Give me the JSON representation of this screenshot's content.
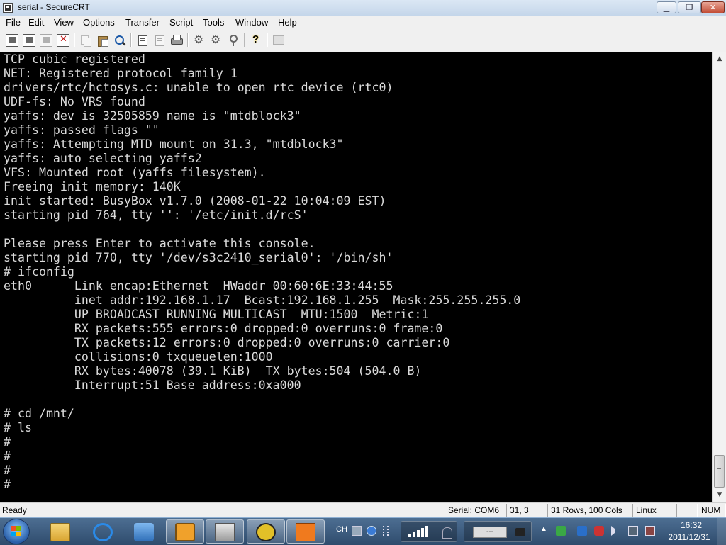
{
  "window": {
    "title": "serial - SecureCRT",
    "min_glyph": "▁",
    "max_glyph": "❐",
    "close_glyph": "✕"
  },
  "menu": {
    "items": [
      "File",
      "Edit",
      "View",
      "Options",
      "Transfer",
      "Script",
      "Tools",
      "Window",
      "Help"
    ]
  },
  "terminal": {
    "lines": [
      "TCP cubic registered",
      "NET: Registered protocol family 1",
      "drivers/rtc/hctosys.c: unable to open rtc device (rtc0)",
      "UDF-fs: No VRS found",
      "yaffs: dev is 32505859 name is \"mtdblock3\"",
      "yaffs: passed flags \"\"",
      "yaffs: Attempting MTD mount on 31.3, \"mtdblock3\"",
      "yaffs: auto selecting yaffs2",
      "VFS: Mounted root (yaffs filesystem).",
      "Freeing init memory: 140K",
      "init started: BusyBox v1.7.0 (2008-01-22 10:04:09 EST)",
      "starting pid 764, tty '': '/etc/init.d/rcS'",
      "",
      "Please press Enter to activate this console.",
      "starting pid 770, tty '/dev/s3c2410_serial0': '/bin/sh'",
      "# ifconfig",
      "eth0      Link encap:Ethernet  HWaddr 00:60:6E:33:44:55",
      "          inet addr:192.168.1.17  Bcast:192.168.1.255  Mask:255.255.255.0",
      "          UP BROADCAST RUNNING MULTICAST  MTU:1500  Metric:1",
      "          RX packets:555 errors:0 dropped:0 overruns:0 frame:0",
      "          TX packets:12 errors:0 dropped:0 overruns:0 carrier:0",
      "          collisions:0 txqueuelen:1000",
      "          RX bytes:40078 (39.1 KiB)  TX bytes:504 (504.0 B)",
      "          Interrupt:51 Base address:0xa000",
      "",
      "# cd /mnt/",
      "# ls",
      "#",
      "#",
      "#",
      "#"
    ],
    "text_color": "#dadada",
    "background": "#000000"
  },
  "status": {
    "ready": "Ready",
    "connection": "Serial: COM6",
    "cursor_position": "31,   3",
    "size": "31 Rows, 100 Cols",
    "emulation": "Linux",
    "num": "NUM"
  },
  "taskbar": {
    "language": "CH",
    "clock_time": "16:32",
    "clock_date": "2011/12/31",
    "tray_placeholder": "---"
  },
  "icons": {
    "app": "securecrt-icon",
    "toolbar": [
      "connect-icon",
      "quick-connect-icon",
      "connect-tab-icon",
      "disconnect-icon",
      "copy-icon",
      "paste-icon",
      "find-icon",
      "log-session-icon",
      "print-icon",
      "print-selection-icon",
      "session-options-icon",
      "global-options-icon",
      "key-icon",
      "help-icon",
      "screen-icon"
    ]
  }
}
